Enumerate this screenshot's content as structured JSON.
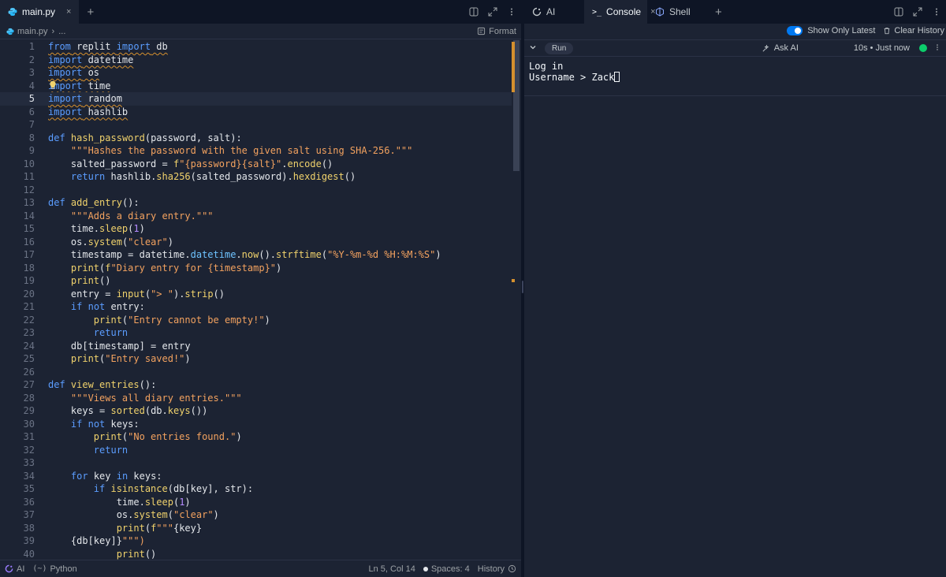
{
  "editor_tab": {
    "label": "main.py",
    "close": "×",
    "add": "+"
  },
  "breadcrumb": {
    "file": "main.py",
    "separator": "›",
    "ellipsis": "...",
    "format_label": "Format"
  },
  "code_lines": [
    "from replit import db",
    "import datetime",
    "import os",
    "import time",
    "import random",
    "import hashlib",
    "",
    "def hash_password(password, salt):",
    "    \"\"\"Hashes the password with the given salt using SHA-256.\"\"\"",
    "    salted_password = f\"{password}{salt}\".encode()",
    "    return hashlib.sha256(salted_password).hexdigest()",
    "",
    "def add_entry():",
    "    \"\"\"Adds a diary entry.\"\"\"",
    "    time.sleep(1)",
    "    os.system(\"clear\")",
    "    timestamp = datetime.datetime.now().strftime(\"%Y-%m-%d %H:%M:%S\")",
    "    print(f\"Diary entry for {timestamp}\")",
    "    print()",
    "    entry = input(\"> \").strip()",
    "    if not entry:",
    "        print(\"Entry cannot be empty!\")",
    "        return",
    "    db[timestamp] = entry",
    "    print(\"Entry saved!\")",
    "",
    "def view_entries():",
    "    \"\"\"Views all diary entries.\"\"\"",
    "    keys = sorted(db.keys())",
    "    if not keys:",
    "        print(\"No entries found.\")",
    "        return",
    "",
    "    for key in keys:",
    "        if isinstance(db[key], str):",
    "            time.sleep(1)",
    "            os.system(\"clear\")",
    "            print(f\"\"\"{key}",
    "    {db[key]}\"\"\")",
    "            print()"
  ],
  "line_numbers": [
    "1",
    "2",
    "3",
    "4",
    "5",
    "6",
    "7",
    "8",
    "9",
    "10",
    "11",
    "12",
    "13",
    "14",
    "15",
    "16",
    "17",
    "18",
    "19",
    "20",
    "21",
    "22",
    "23",
    "24",
    "25",
    "26",
    "27",
    "28",
    "29",
    "30",
    "31",
    "32",
    "33",
    "34",
    "35",
    "36",
    "37",
    "38",
    "39",
    "40"
  ],
  "status": {
    "ai_label": "AI",
    "language": "Python",
    "cursor": "Ln 5, Col 14",
    "spaces": "Spaces: 4",
    "history": "History"
  },
  "right_tabs": [
    {
      "label": "AI",
      "icon": "ai-icon"
    },
    {
      "label": "Console",
      "icon": "terminal-icon",
      "close": "×"
    },
    {
      "label": "Shell",
      "icon": "shell-icon"
    }
  ],
  "right_add": "+",
  "console": {
    "show_only_latest": "Show Only Latest",
    "clear_history": "Clear History",
    "run_label": "Run",
    "ask_ai": "Ask AI",
    "run_meta": "10s • Just now",
    "output_line1": "Log in",
    "output_line2": "Username > Zack"
  },
  "colors": {
    "background": "#1c2333",
    "keyword": "#5b9dff",
    "function": "#f0d26c",
    "string": "#f3a25f",
    "toggle": "#0079f2",
    "status_ok": "#0cce6b"
  }
}
